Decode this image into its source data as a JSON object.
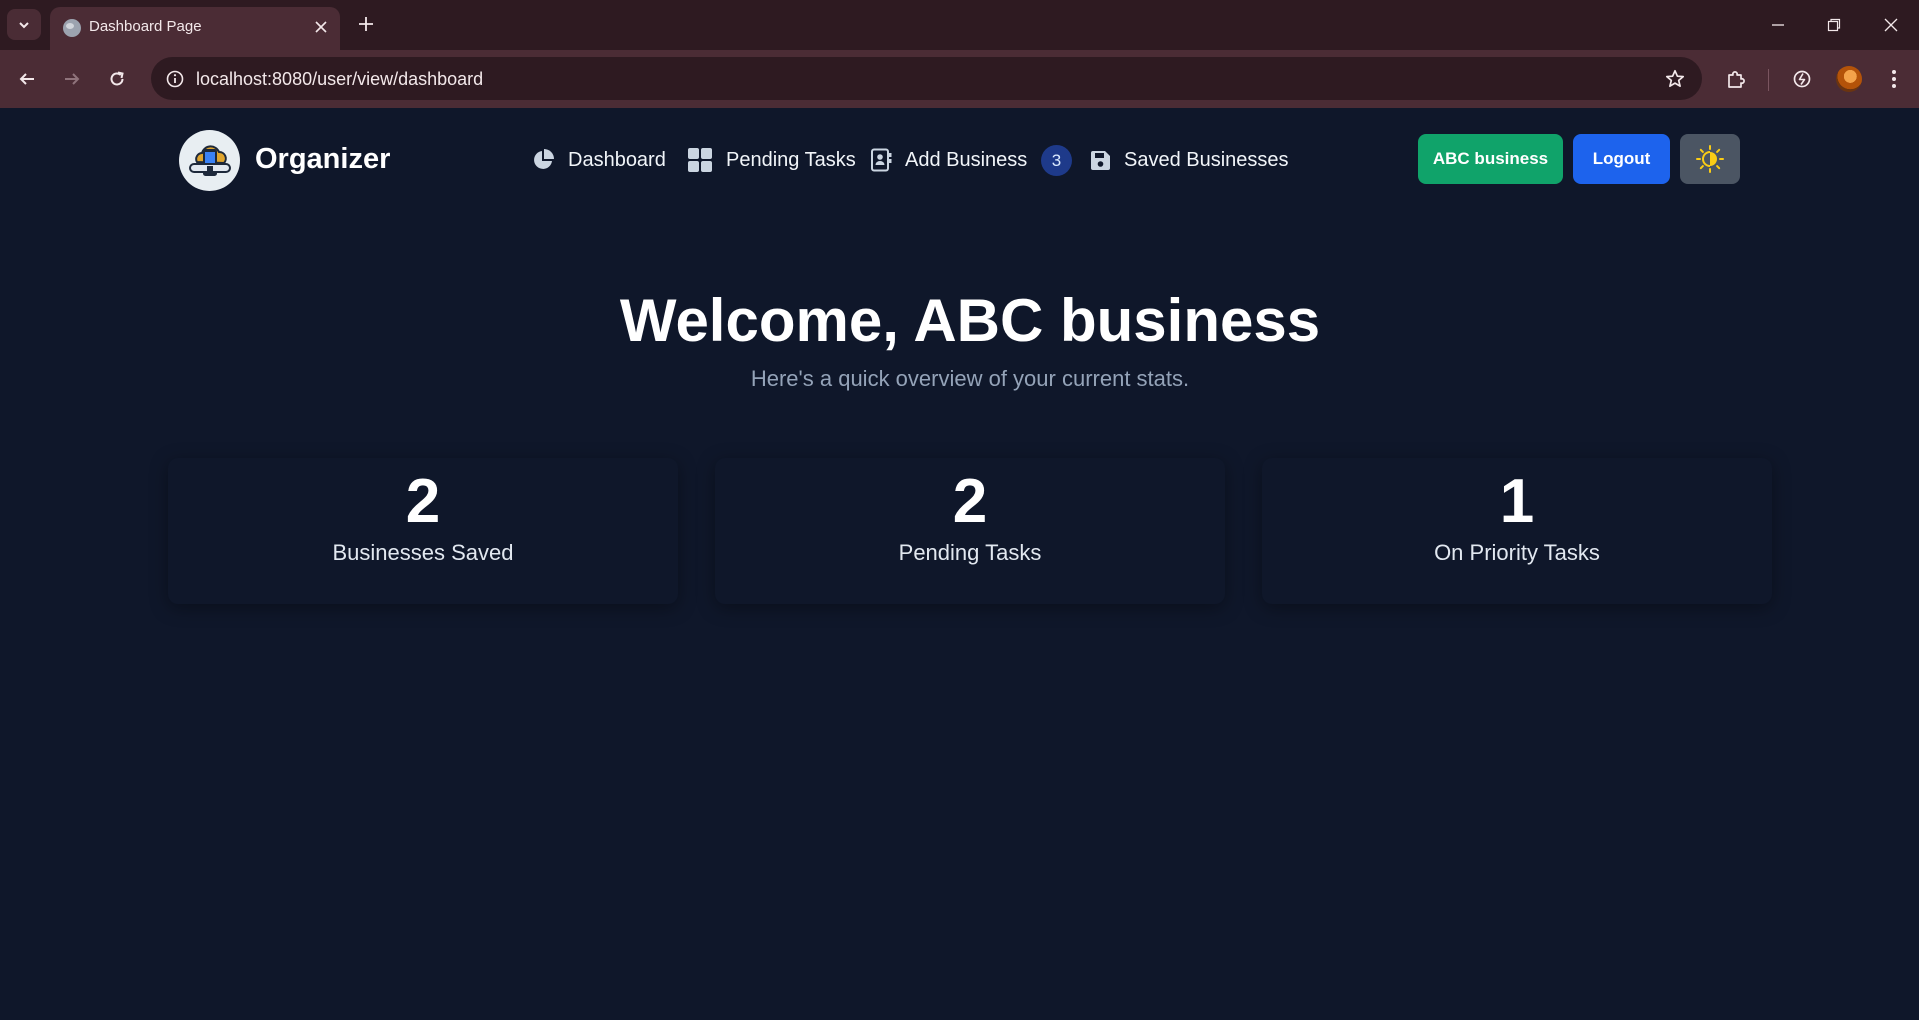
{
  "browser": {
    "tab_title": "Dashboard Page",
    "url": "localhost:8080/user/view/dashboard",
    "icons": {
      "tab_search": "chevron-down-icon",
      "favicon": "globe-icon",
      "close": "close-icon",
      "new_tab": "plus-icon",
      "back": "arrow-left-icon",
      "forward": "arrow-right-icon",
      "reload": "reload-icon",
      "site_info": "info-icon",
      "bookmark": "star-icon",
      "extensions": "puzzle-icon",
      "performance": "gauge-icon",
      "menu": "kebab-menu-icon"
    },
    "chrome_color": "#4b2c35"
  },
  "app": {
    "brand": "Organizer",
    "nav": [
      {
        "label": "Dashboard",
        "icon": "pie-chart-icon"
      },
      {
        "label": "Pending Tasks",
        "icon": "grid-icon"
      },
      {
        "label": "Add Business",
        "icon": "address-book-icon"
      },
      {
        "label": "Saved Businesses",
        "icon": "save-icon"
      }
    ],
    "badge_count": "3",
    "user_button": "ABC business",
    "logout_button": "Logout",
    "theme_icon": "sun-icon",
    "colors": {
      "background": "#0f172a",
      "user_button": "#10a36a",
      "logout_button": "#1d63ed",
      "theme_button": "#4b5563",
      "badge": "#1e3a8a"
    }
  },
  "main": {
    "welcome": "Welcome, ABC business",
    "subtitle": "Here's a quick overview of your current stats.",
    "stats": [
      {
        "value": "2",
        "label": "Businesses Saved"
      },
      {
        "value": "2",
        "label": "Pending Tasks"
      },
      {
        "value": "1",
        "label": "On Priority Tasks"
      }
    ]
  }
}
